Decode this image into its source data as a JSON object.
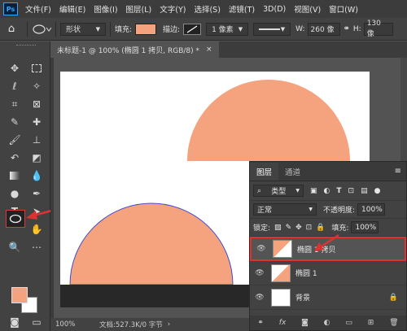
{
  "app": {
    "logo": "Ps",
    "menus": [
      "文件(F)",
      "编辑(E)",
      "图像(I)",
      "图层(L)",
      "文字(Y)",
      "选择(S)",
      "滤镜(T)",
      "3D(D)",
      "视图(V)",
      "窗口(W)"
    ]
  },
  "options": {
    "mode": "形状",
    "fill_label": "填充:",
    "stroke_label": "描边:",
    "stroke_size": "1 像素",
    "w_label": "W:",
    "w_value": "260 像",
    "h_value": "130 像",
    "fill_color": "#f4a37e"
  },
  "document": {
    "tab_title": "未标题-1 @ 100% (椭圆 1 拷贝, RGB/8) *",
    "close": "×"
  },
  "status": {
    "zoom": "100%",
    "doc_info": "文档:527.3K/0 字节"
  },
  "layers_panel": {
    "tabs": [
      "图层",
      "通道"
    ],
    "filter_kind": "类型",
    "blend_mode": "正常",
    "opacity_label": "不透明度:",
    "opacity": "100%",
    "lock_label": "锁定:",
    "fill_label": "填充:",
    "fill": "100%",
    "layers": [
      {
        "name": "椭圆 1 拷贝",
        "selected": true
      },
      {
        "name": "椭圆 1",
        "selected": false
      },
      {
        "name": "背景",
        "selected": false
      }
    ],
    "footer_fx": "fx"
  },
  "colors": {
    "shape": "#f4a37e",
    "accent_red": "#e03131"
  }
}
